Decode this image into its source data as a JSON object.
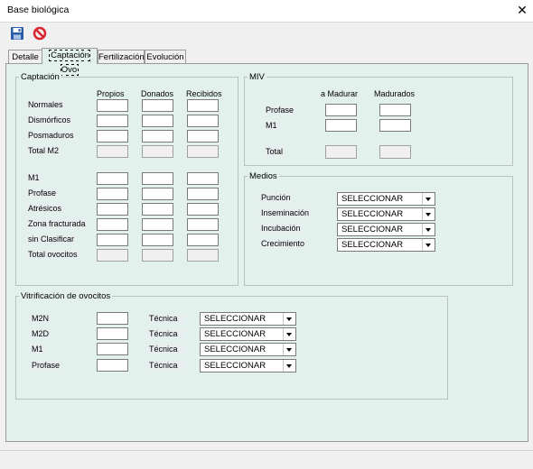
{
  "window": {
    "title": "Base biológica",
    "close_glyph": "✕"
  },
  "toolbar": {
    "save_icon": "save-icon",
    "cancel_icon": "cancel-icon",
    "cancel_color": "#d9232e",
    "save_color": "#2a5da8"
  },
  "tabs": [
    {
      "label": "Detalle",
      "active": false
    },
    {
      "label": "Captación Ovo",
      "active": true
    },
    {
      "label": "Fertilización",
      "active": false
    },
    {
      "label": "Evolución",
      "active": false
    }
  ],
  "captacion": {
    "title": "Captación",
    "columns": [
      "Propios",
      "Donados",
      "Recibidos"
    ],
    "rows1": [
      "Normales",
      "Dismórficos",
      "Posmaduros",
      "Total M2"
    ],
    "rows2": [
      "M1",
      "Profase",
      "Atrésicos",
      "Zona fracturada",
      "sin Clasificar",
      "Total ovocitos"
    ]
  },
  "miv": {
    "title": "MIV",
    "columns": [
      "a Madurar",
      "Madurados"
    ],
    "rows": [
      "Profase",
      "M1",
      "Total"
    ]
  },
  "medios": {
    "title": "Medios",
    "rows": [
      {
        "label": "Punción",
        "value": "SELECCIONAR"
      },
      {
        "label": "Inseminación",
        "value": "SELECCIONAR"
      },
      {
        "label": "Incubación",
        "value": "SELECCIONAR"
      },
      {
        "label": "Crecimiento",
        "value": "SELECCIONAR"
      }
    ]
  },
  "vitrificacion": {
    "title": "Vitrificación de ovocitos",
    "tecnica_label": "Técnica",
    "rows": [
      {
        "label": "M2N",
        "value": "SELECCIONAR"
      },
      {
        "label": "M2D",
        "value": "SELECCIONAR"
      },
      {
        "label": "M1",
        "value": "SELECCIONAR"
      },
      {
        "label": "Profase",
        "value": "SELECCIONAR"
      }
    ]
  },
  "colors": {
    "panel_bg": "#e3f1ec",
    "window_bg": "#f0f0f0"
  }
}
